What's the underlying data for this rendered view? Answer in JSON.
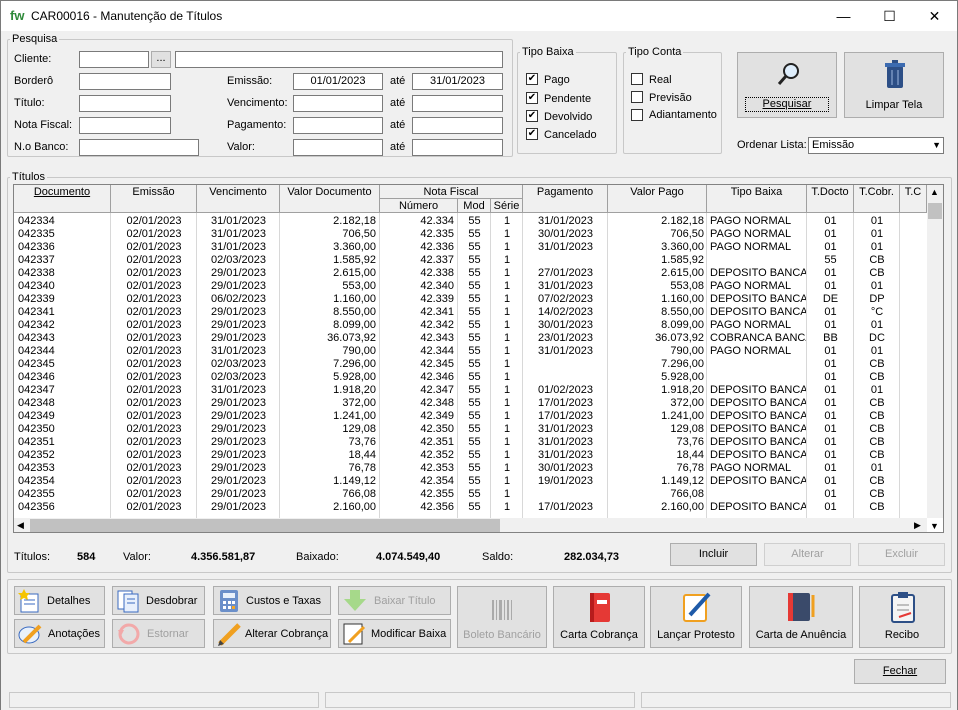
{
  "window": {
    "title": "CAR00016 - Manutenção de Títulos",
    "logo": "fw"
  },
  "pesquisa": {
    "legend": "Pesquisa",
    "cliente_label": "Cliente:",
    "cliente_value": "",
    "cliente_name": "",
    "bordero_label": "Borderô",
    "titulo_label": "Título:",
    "nota_label": "Nota Fiscal:",
    "nobanco_label": "N.o Banco:",
    "emissao_label": "Emissão:",
    "emissao_de": "01/01/2023",
    "emissao_ate": "31/01/2023",
    "vencimento_label": "Vencimento:",
    "pagamento_label": "Pagamento:",
    "valor_label": "Valor:",
    "ate": "até",
    "ellipsis": "..."
  },
  "tipo_baixa": {
    "legend": "Tipo Baixa",
    "items": [
      {
        "label": "Pago",
        "checked": true
      },
      {
        "label": "Pendente",
        "checked": true
      },
      {
        "label": "Devolvido",
        "checked": true
      },
      {
        "label": "Cancelado",
        "checked": true
      }
    ]
  },
  "tipo_conta": {
    "legend": "Tipo Conta",
    "items": [
      {
        "label": "Real",
        "checked": false
      },
      {
        "label": "Previsão",
        "checked": false
      },
      {
        "label": "Adiantamento",
        "checked": false
      }
    ]
  },
  "buttons": {
    "pesquisar": "Pesquisar",
    "limpar": "Limpar Tela",
    "ordenar_label": "Ordenar Lista:",
    "ordenar_value": "Emissão"
  },
  "titulos": {
    "legend": "Títulos",
    "headers": {
      "documento": "Documento",
      "emissao": "Emissão",
      "vencimento": "Vencimento",
      "valor_documento": "Valor Documento",
      "nota_fiscal": "Nota Fiscal",
      "numero": "Número",
      "mod": "Mod",
      "serie": "Série",
      "pagamento": "Pagamento",
      "valor_pago": "Valor Pago",
      "tipo_baixa": "Tipo Baixa",
      "tdocto": "T.Docto",
      "tcobr": "T.Cobr.",
      "tc": "T.C"
    },
    "rows": [
      [
        "042334",
        "02/01/2023",
        "31/01/2023",
        "2.182,18",
        "42.334",
        "55",
        "1",
        "31/01/2023",
        "2.182,18",
        "PAGO NORMAL",
        "01",
        "01"
      ],
      [
        "042335",
        "02/01/2023",
        "31/01/2023",
        "706,50",
        "42.335",
        "55",
        "1",
        "30/01/2023",
        "706,50",
        "PAGO NORMAL",
        "01",
        "01"
      ],
      [
        "042336",
        "02/01/2023",
        "31/01/2023",
        "3.360,00",
        "42.336",
        "55",
        "1",
        "31/01/2023",
        "3.360,00",
        "PAGO NORMAL",
        "01",
        "01"
      ],
      [
        "042337",
        "02/01/2023",
        "02/03/2023",
        "1.585,92",
        "42.337",
        "55",
        "1",
        "",
        "1.585,92",
        "",
        "55",
        "CB"
      ],
      [
        "042338",
        "02/01/2023",
        "29/01/2023",
        "2.615,00",
        "42.338",
        "55",
        "1",
        "27/01/2023",
        "2.615,00",
        "DEPOSITO BANCA",
        "01",
        "CB"
      ],
      [
        "042340",
        "02/01/2023",
        "29/01/2023",
        "553,00",
        "42.340",
        "55",
        "1",
        "31/01/2023",
        "553,08",
        "PAGO NORMAL",
        "01",
        "01"
      ],
      [
        "042339",
        "02/01/2023",
        "06/02/2023",
        "1.160,00",
        "42.339",
        "55",
        "1",
        "07/02/2023",
        "1.160,00",
        "DEPOSITO BANCA",
        "DE",
        "DP"
      ],
      [
        "042341",
        "02/01/2023",
        "29/01/2023",
        "8.550,00",
        "42.341",
        "55",
        "1",
        "14/02/2023",
        "8.550,00",
        "DEPOSITO BANCA",
        "01",
        "°C"
      ],
      [
        "042342",
        "02/01/2023",
        "29/01/2023",
        "8.099,00",
        "42.342",
        "55",
        "1",
        "30/01/2023",
        "8.099,00",
        "PAGO NORMAL",
        "01",
        "01"
      ],
      [
        "042343",
        "02/01/2023",
        "29/01/2023",
        "36.073,92",
        "42.343",
        "55",
        "1",
        "23/01/2023",
        "36.073,92",
        "COBRANCA BANCA",
        "BB",
        "DC"
      ],
      [
        "042344",
        "02/01/2023",
        "31/01/2023",
        "790,00",
        "42.344",
        "55",
        "1",
        "31/01/2023",
        "790,00",
        "PAGO NORMAL",
        "01",
        "01"
      ],
      [
        "042345",
        "02/01/2023",
        "02/03/2023",
        "7.296,00",
        "42.345",
        "55",
        "1",
        "",
        "7.296,00",
        "",
        "01",
        "CB"
      ],
      [
        "042346",
        "02/01/2023",
        "02/03/2023",
        "5.928,00",
        "42.346",
        "55",
        "1",
        "",
        "5.928,00",
        "",
        "01",
        "CB"
      ],
      [
        "042347",
        "02/01/2023",
        "31/01/2023",
        "1.918,20",
        "42.347",
        "55",
        "1",
        "01/02/2023",
        "1.918,20",
        "DEPOSITO BANCA",
        "01",
        "01"
      ],
      [
        "042348",
        "02/01/2023",
        "29/01/2023",
        "372,00",
        "42.348",
        "55",
        "1",
        "17/01/2023",
        "372,00",
        "DEPOSITO BANCA",
        "01",
        "CB"
      ],
      [
        "042349",
        "02/01/2023",
        "29/01/2023",
        "1.241,00",
        "42.349",
        "55",
        "1",
        "17/01/2023",
        "1.241,00",
        "DEPOSITO BANCA",
        "01",
        "CB"
      ],
      [
        "042350",
        "02/01/2023",
        "29/01/2023",
        "129,08",
        "42.350",
        "55",
        "1",
        "31/01/2023",
        "129,08",
        "DEPOSITO BANCA",
        "01",
        "CB"
      ],
      [
        "042351",
        "02/01/2023",
        "29/01/2023",
        "73,76",
        "42.351",
        "55",
        "1",
        "31/01/2023",
        "73,76",
        "DEPOSITO BANCA",
        "01",
        "CB"
      ],
      [
        "042352",
        "02/01/2023",
        "29/01/2023",
        "18,44",
        "42.352",
        "55",
        "1",
        "31/01/2023",
        "18,44",
        "DEPOSITO BANCA",
        "01",
        "CB"
      ],
      [
        "042353",
        "02/01/2023",
        "29/01/2023",
        "76,78",
        "42.353",
        "55",
        "1",
        "30/01/2023",
        "76,78",
        "PAGO NORMAL",
        "01",
        "01"
      ],
      [
        "042354",
        "02/01/2023",
        "29/01/2023",
        "1.149,12",
        "42.354",
        "55",
        "1",
        "19/01/2023",
        "1.149,12",
        "DEPOSITO BANCA",
        "01",
        "CB"
      ],
      [
        "042355",
        "02/01/2023",
        "29/01/2023",
        "766,08",
        "42.355",
        "55",
        "1",
        "",
        "766,08",
        "",
        "01",
        "CB"
      ],
      [
        "042356",
        "02/01/2023",
        "29/01/2023",
        "2.160,00",
        "42.356",
        "55",
        "1",
        "17/01/2023",
        "2.160,00",
        "DEPOSITO BANCA",
        "01",
        "CB"
      ]
    ]
  },
  "totais": {
    "titulos_label": "Títulos:",
    "titulos": "584",
    "valor_label": "Valor:",
    "valor": "4.356.581,87",
    "baixado_label": "Baixado:",
    "baixado": "4.074.549,40",
    "saldo_label": "Saldo:",
    "saldo": "282.034,73"
  },
  "grid_actions": {
    "incluir": "Incluir",
    "alterar": "Alterar",
    "excluir": "Excluir"
  },
  "toolbar": {
    "detalhes": "Detalhes",
    "desdobrar": "Desdobrar",
    "custos": "Custos e Taxas",
    "baixar": "Baixar Título",
    "anotacoes": "Anotações",
    "estornar": "Estornar",
    "alterar_cobranca": "Alterar Cobrança",
    "modificar_baixa": "Modificar Baixa",
    "boleto": "Boleto Bancário",
    "carta_cobranca": "Carta Cobrança",
    "lancar_protesto": "Lançar Protesto",
    "carta_anuencia": "Carta de Anuência",
    "recibo": "Recibo"
  },
  "fechar": "Fechar",
  "colors": {
    "accent": "#2f8a3a",
    "pasta": "#e53935",
    "ink": "#1e5aa8"
  }
}
